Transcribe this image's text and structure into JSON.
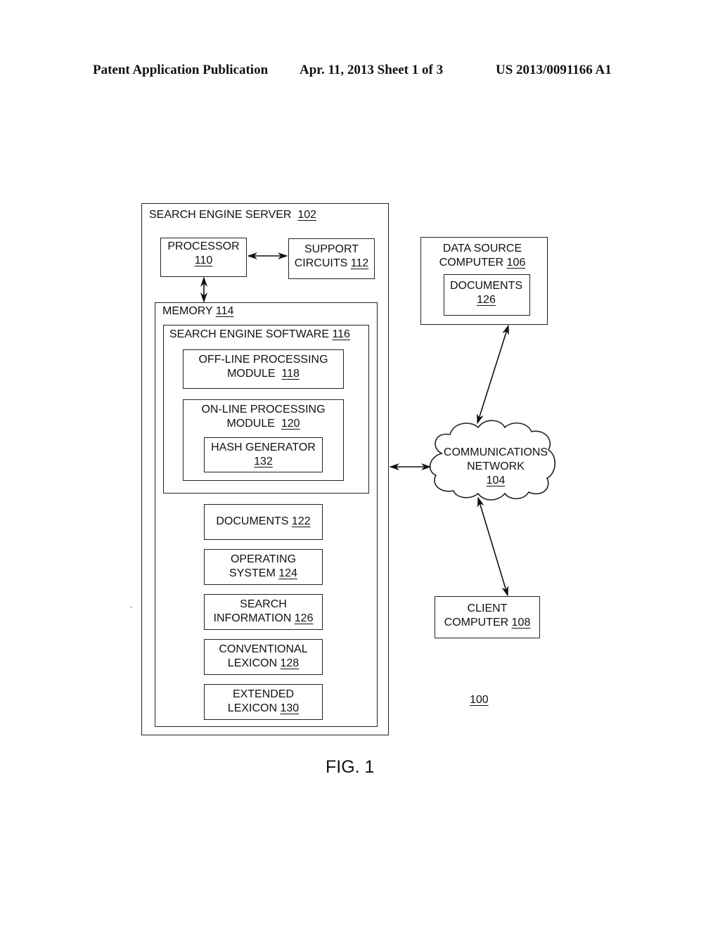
{
  "header": {
    "publication": "Patent Application Publication",
    "date_sheet": "Apr. 11, 2013  Sheet 1 of 3",
    "number": "US 2013/0091166 A1"
  },
  "figure": {
    "caption": "FIG. 1",
    "system_ref": "100"
  },
  "server": {
    "label": "SEARCH ENGINE SERVER",
    "ref": "102",
    "processor": {
      "label": "PROCESSOR",
      "ref": "110"
    },
    "support": {
      "label1": "SUPPORT",
      "label2": "CIRCUITS",
      "ref": "112"
    },
    "memory": {
      "label": "MEMORY",
      "ref": "114",
      "software": {
        "label": "SEARCH ENGINE SOFTWARE",
        "ref": "116",
        "offline": {
          "label1": "OFF-LINE PROCESSING",
          "label2": "MODULE",
          "ref": "118"
        },
        "online": {
          "label1": "ON-LINE PROCESSING",
          "label2": "MODULE",
          "ref": "120"
        },
        "hash": {
          "label": "HASH GENERATOR",
          "ref": "132"
        }
      },
      "items": [
        {
          "label1": "",
          "label2": "DOCUMENTS",
          "ref": "122"
        },
        {
          "label1": "OPERATING",
          "label2": "SYSTEM",
          "ref": "124"
        },
        {
          "label1": "SEARCH",
          "label2": "INFORMATION",
          "ref": "126"
        },
        {
          "label1": "CONVENTIONAL",
          "label2": "LEXICON",
          "ref": "128"
        },
        {
          "label1": "EXTENDED",
          "label2": "LEXICON",
          "ref": "130"
        }
      ]
    }
  },
  "data_source": {
    "label1": "DATA SOURCE",
    "label2": "COMPUTER",
    "ref": "106",
    "documents": {
      "label": "DOCUMENTS",
      "ref": "126"
    }
  },
  "network": {
    "label1": "COMMUNICATIONS",
    "label2": "NETWORK",
    "ref": "104"
  },
  "client": {
    "label1": "CLIENT",
    "label2": "COMPUTER",
    "ref": "108"
  }
}
